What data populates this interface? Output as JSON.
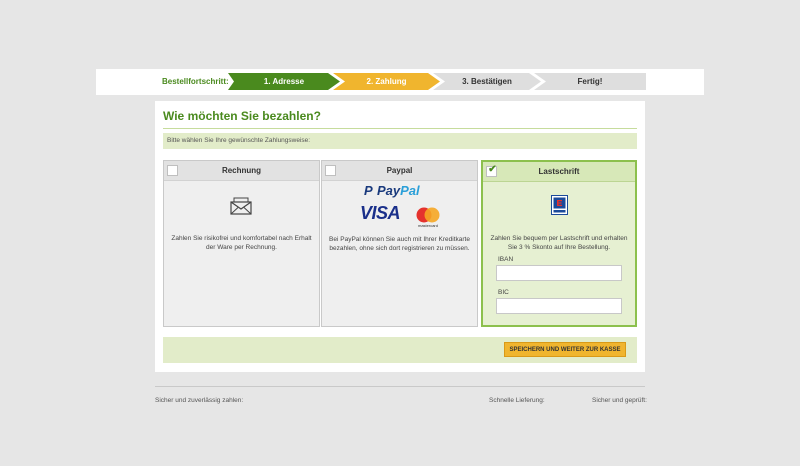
{
  "progress": {
    "label": "Bestellfortschritt:",
    "steps": [
      "1. Adresse",
      "2. Zahlung",
      "3. Bestätigen",
      "Fertig!"
    ],
    "active_step": 2
  },
  "payment": {
    "title": "Wie möchten Sie bezahlen?",
    "notice": "Bitte wählen Sie Ihre gewünschte Zahlungsweise:",
    "options": [
      {
        "title": "Rechnung",
        "checked": false,
        "icon": "envelope-icon",
        "description": "Zahlen Sie risikofrei und komfortabel nach Erhalt der Ware per Rechnung."
      },
      {
        "title": "Paypal",
        "checked": false,
        "icon": "paypal-visa-mastercard-logos",
        "logo_paypal_1": "Pay",
        "logo_paypal_2": "Pal",
        "logo_visa": "VISA",
        "logo_mastercard": "mastercard",
        "description": "Bei PayPal können Sie auch mit Ihrer Kreditkarte bezahlen, ohne sich dort registrieren zu müssen."
      },
      {
        "title": "Lastschrift",
        "checked": true,
        "icon": "ec-logo",
        "description": "Zahlen Sie bequem per Lastschrift und erhalten Sie 3 % Skonto auf Ihre Bestellung.",
        "iban_label": "IBAN",
        "iban_value": "",
        "bic_label": "BIC",
        "bic_value": ""
      }
    ],
    "submit_label": "SPEICHERN UND WEITER ZUR KASSE"
  },
  "footer": {
    "secure_pay": "Sicher und zuverlässig zahlen:",
    "fast_delivery": "Schnelle Lieferung:",
    "secure_checked": "Sicher und geprüft:"
  },
  "colors": {
    "green": "#4a8a1e",
    "yellow": "#f0b52e",
    "light_green": "#e2ecc9",
    "grey": "#dedede"
  }
}
